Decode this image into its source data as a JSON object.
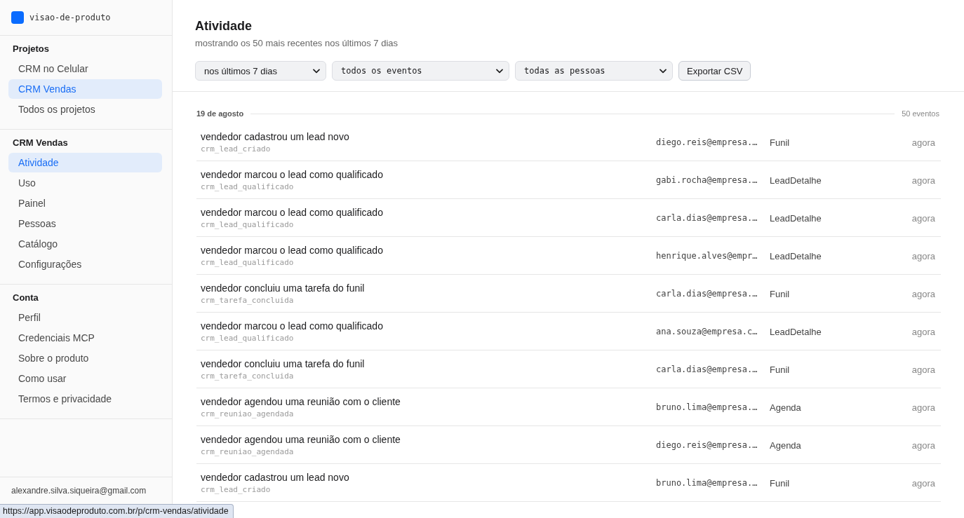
{
  "sidebar": {
    "brand": "visao-de-produto",
    "sections": [
      {
        "title": "Projetos",
        "items": [
          {
            "label": "CRM no Celular",
            "selected": false
          },
          {
            "label": "CRM Vendas",
            "selected": true
          },
          {
            "label": "Todos os projetos",
            "selected": false
          }
        ]
      },
      {
        "title": "CRM Vendas",
        "items": [
          {
            "label": "Atividade",
            "selected": true
          },
          {
            "label": "Uso",
            "selected": false
          },
          {
            "label": "Painel",
            "selected": false
          },
          {
            "label": "Pessoas",
            "selected": false
          },
          {
            "label": "Catálogo",
            "selected": false
          },
          {
            "label": "Configurações",
            "selected": false
          }
        ]
      },
      {
        "title": "Conta",
        "items": [
          {
            "label": "Perfil",
            "selected": false
          },
          {
            "label": "Credenciais MCP",
            "selected": false
          },
          {
            "label": "Sobre o produto",
            "selected": false
          },
          {
            "label": "Como usar",
            "selected": false
          },
          {
            "label": "Termos e privacidade",
            "selected": false
          }
        ]
      }
    ],
    "footer": {
      "email": "alexandre.silva.siqueira@gmail.com"
    }
  },
  "header": {
    "title": "Atividade",
    "subtitle": "mostrando os 50 mais recentes nos últimos 7 dias",
    "filters": [
      {
        "kind": "text",
        "value": "nos últimos 7 dias"
      },
      {
        "kind": "code",
        "value": "todos os eventos"
      },
      {
        "kind": "code",
        "value": "todas as pessoas"
      }
    ],
    "export_button": "Exportar CSV"
  },
  "groups": [
    {
      "date": "19 de agosto",
      "count": "50 eventos",
      "events": [
        {
          "title": "vendedor cadastrou um lead novo",
          "event": "crm_lead_criado",
          "user": "diego.reis@empresa.…",
          "screen": "Funil",
          "time": "agora"
        },
        {
          "title": "vendedor marcou o lead como qualificado",
          "event": "crm_lead_qualificado",
          "user": "gabi.rocha@empresa.…",
          "screen": "LeadDetalhe",
          "time": "agora"
        },
        {
          "title": "vendedor marcou o lead como qualificado",
          "event": "crm_lead_qualificado",
          "user": "carla.dias@empresa.…",
          "screen": "LeadDetalhe",
          "time": "agora"
        },
        {
          "title": "vendedor marcou o lead como qualificado",
          "event": "crm_lead_qualificado",
          "user": "henrique.alves@empr…",
          "screen": "LeadDetalhe",
          "time": "agora"
        },
        {
          "title": "vendedor concluiu uma tarefa do funil",
          "event": "crm_tarefa_concluida",
          "user": "carla.dias@empresa.…",
          "screen": "Funil",
          "time": "agora"
        },
        {
          "title": "vendedor marcou o lead como qualificado",
          "event": "crm_lead_qualificado",
          "user": "ana.souza@empresa.c…",
          "screen": "LeadDetalhe",
          "time": "agora"
        },
        {
          "title": "vendedor concluiu uma tarefa do funil",
          "event": "crm_tarefa_concluida",
          "user": "carla.dias@empresa.…",
          "screen": "Funil",
          "time": "agora"
        },
        {
          "title": "vendedor agendou uma reunião com o cliente",
          "event": "crm_reuniao_agendada",
          "user": "bruno.lima@empresa.…",
          "screen": "Agenda",
          "time": "agora"
        },
        {
          "title": "vendedor agendou uma reunião com o cliente",
          "event": "crm_reuniao_agendada",
          "user": "diego.reis@empresa.…",
          "screen": "Agenda",
          "time": "agora"
        },
        {
          "title": "vendedor cadastrou um lead novo",
          "event": "crm_lead_criado",
          "user": "bruno.lima@empresa.…",
          "screen": "Funil",
          "time": "agora"
        }
      ]
    }
  ],
  "status_url": "https://app.visaodeproduto.com.br/p/crm-vendas/atividade"
}
